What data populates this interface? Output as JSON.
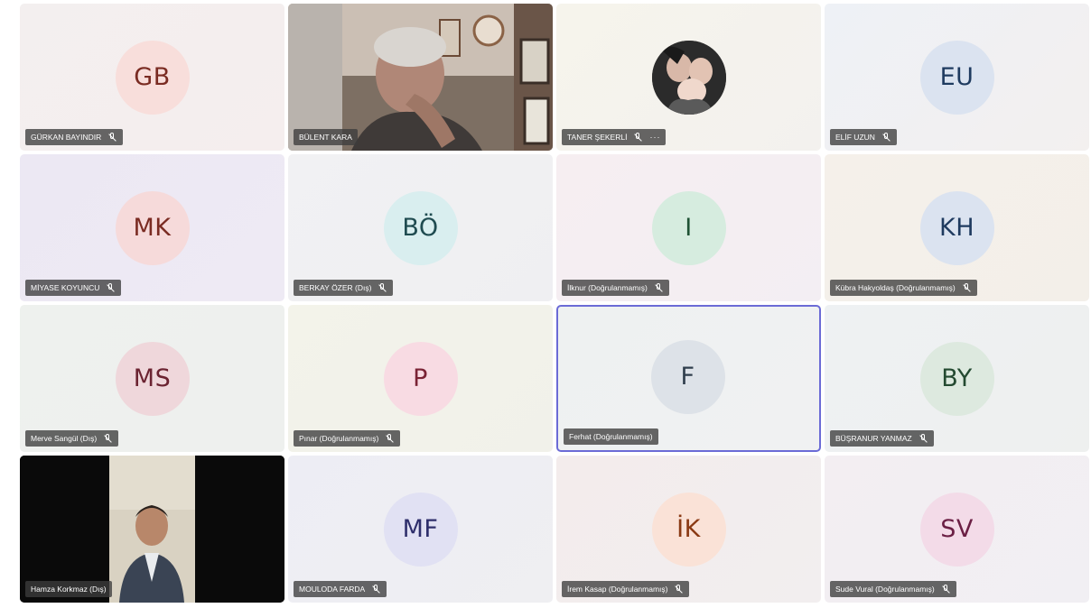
{
  "participants": [
    {
      "name": "GÜRKAN BAYINDIR",
      "initials": "GB",
      "avatar_bg": "#f8dedb",
      "avatar_fg": "#7a2b22",
      "muted": true
    },
    {
      "name": "BÜLENT KARA",
      "video": true
    },
    {
      "name": "TANER ŞEKERLİ",
      "photo": true,
      "muted": true,
      "more_label": "···"
    },
    {
      "name": "ELİF UZUN",
      "initials": "EU",
      "avatar_bg": "#dbe3f0",
      "avatar_fg": "#1e3a5f",
      "muted": true
    },
    {
      "name": "MİYASE KOYUNCU",
      "initials": "MK",
      "avatar_bg": "#f6dada",
      "avatar_fg": "#7a2b22",
      "muted": true
    },
    {
      "name": "BERKAY ÖZER (Dış)",
      "initials": "BÖ",
      "avatar_bg": "#d9eeef",
      "avatar_fg": "#1f4b50",
      "muted": true
    },
    {
      "name": "İlknur (Doğrulanmamış)",
      "initials": "I",
      "avatar_bg": "#d6ecdf",
      "avatar_fg": "#1f5234",
      "muted": true
    },
    {
      "name": "Kübra Hakyoldaş (Doğrulanmamış)",
      "initials": "KH",
      "avatar_bg": "#dbe3f0",
      "avatar_fg": "#1e3a5f",
      "muted": true
    },
    {
      "name": "Merve Sangül (Dış)",
      "initials": "MS",
      "avatar_bg": "#efd7db",
      "avatar_fg": "#6b2331",
      "muted": true
    },
    {
      "name": "Pınar (Doğrulanmamış)",
      "initials": "P",
      "avatar_bg": "#f8dbe3",
      "avatar_fg": "#7a2335",
      "muted": true
    },
    {
      "name": "Ferhat (Doğrulanmamış)",
      "initials": "F",
      "avatar_bg": "#dde2e8",
      "avatar_fg": "#2f3d4c",
      "muted": false,
      "active": true
    },
    {
      "name": "BÜŞRANUR YANMAZ",
      "initials": "BY",
      "avatar_bg": "#dde9df",
      "avatar_fg": "#244a31",
      "muted": true
    },
    {
      "name": "Hamza Korkmaz (Dış)",
      "video": true,
      "muted": false
    },
    {
      "name": "MOULODA FARDA",
      "initials": "MF",
      "avatar_bg": "#e1e1f3",
      "avatar_fg": "#2e2e6b",
      "muted": true
    },
    {
      "name": "İrem Kasap (Doğrulanmamış)",
      "initials": "İK",
      "avatar_bg": "#fae2d7",
      "avatar_fg": "#8a3a14",
      "muted": true
    },
    {
      "name": "Sude Vural (Doğrulanmamış)",
      "initials": "SV",
      "avatar_bg": "#f3dbe8",
      "avatar_fg": "#6b1f44",
      "muted": true
    }
  ]
}
